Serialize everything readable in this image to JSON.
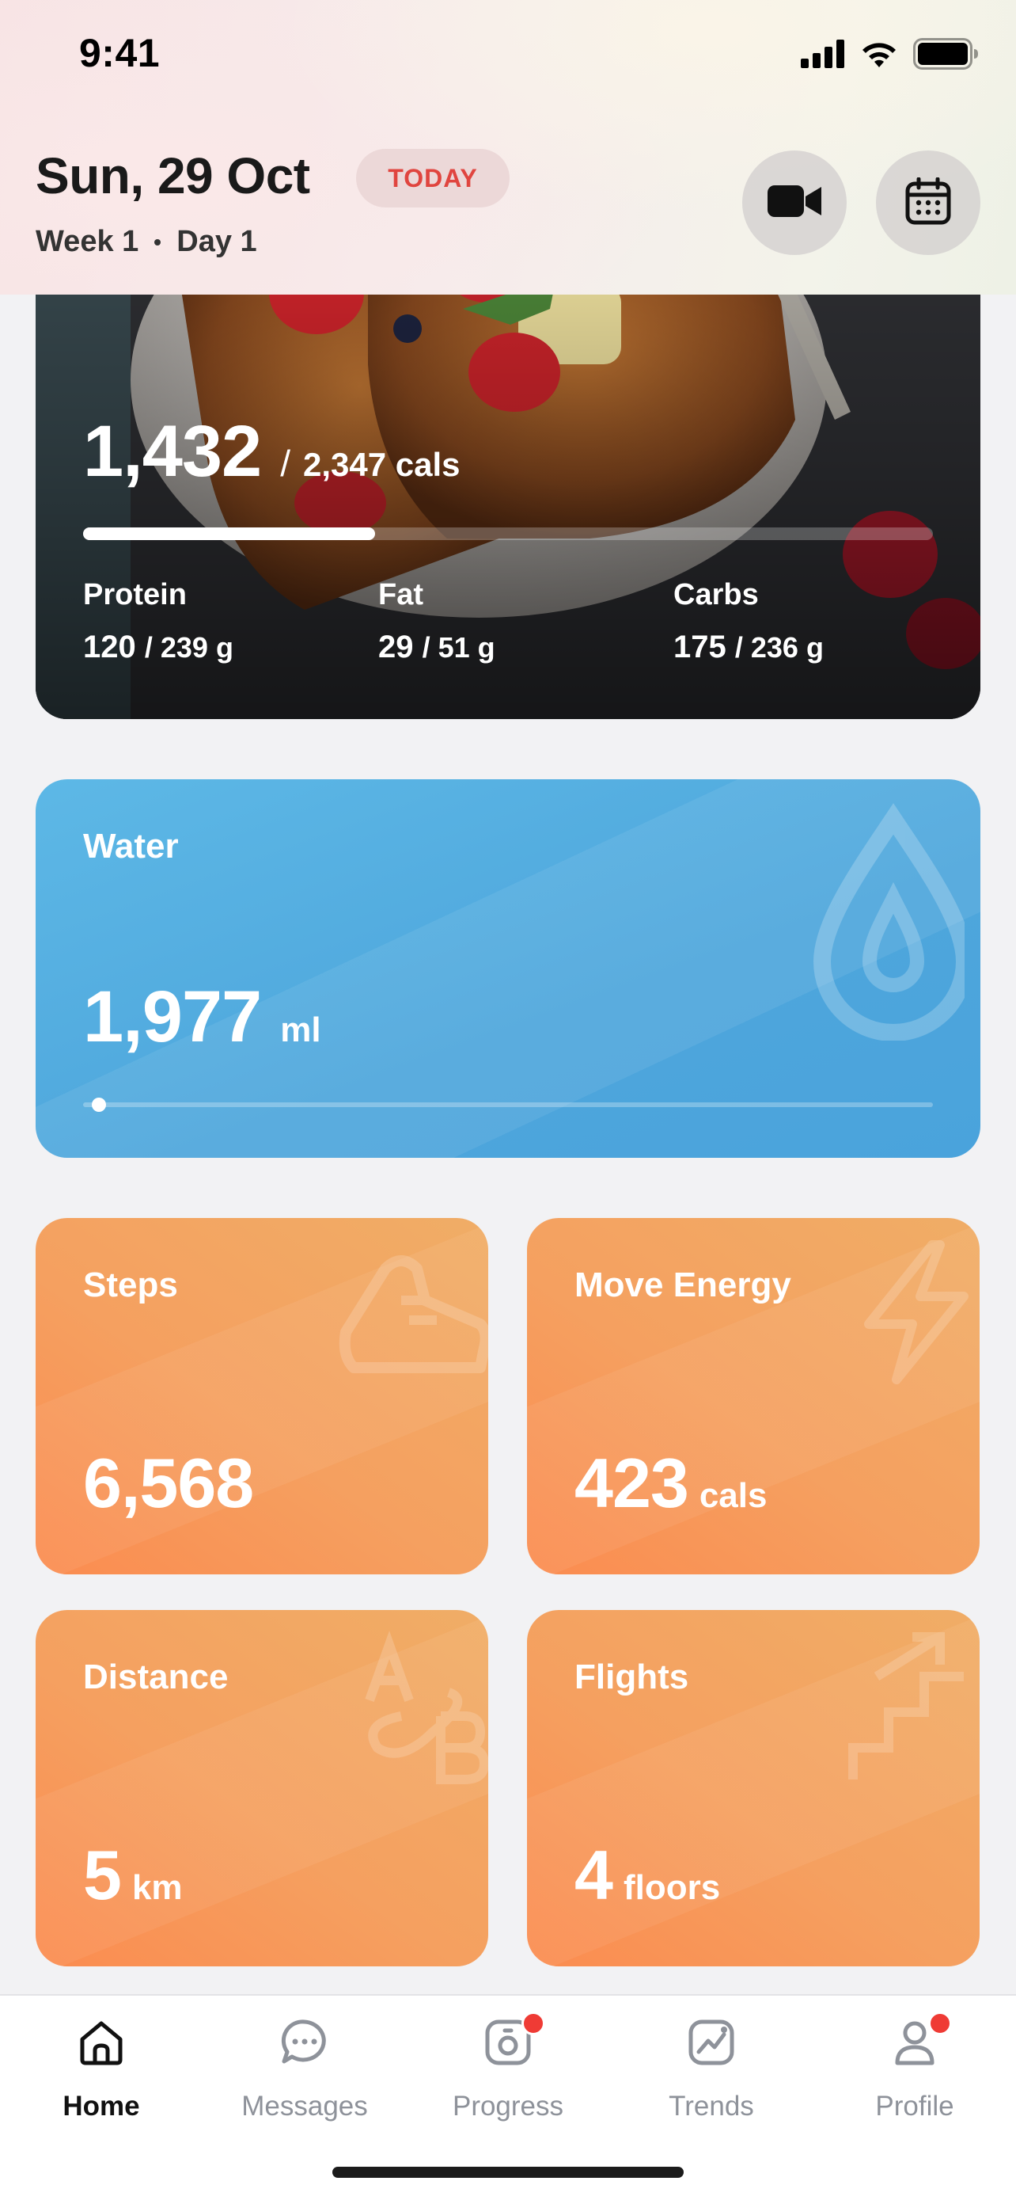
{
  "status_bar": {
    "time": "9:41"
  },
  "header": {
    "date": "Sun, 29 Oct",
    "today_badge": "TODAY",
    "week": "Week 1",
    "day": "Day 1",
    "icons": [
      "video-camera-icon",
      "calendar-icon"
    ]
  },
  "nutrition": {
    "calories_eaten": "1,432",
    "separator": "/",
    "calories_goal": "2,347 cals",
    "progress_fraction": 0.344,
    "macros": [
      {
        "label": "Protein",
        "value": "120",
        "goal": "/ 239 g"
      },
      {
        "label": "Fat",
        "value": "29",
        "goal": "/ 51 g"
      },
      {
        "label": "Carbs",
        "value": "175",
        "goal": "/ 236 g"
      }
    ]
  },
  "water": {
    "title": "Water",
    "value": "1,977",
    "unit": "ml",
    "progress_fraction": 0.01
  },
  "activity": {
    "steps": {
      "title": "Steps",
      "value": "6,568",
      "unit": ""
    },
    "move_energy": {
      "title": "Move Energy",
      "value": "423",
      "unit": "cals"
    },
    "distance": {
      "title": "Distance",
      "value": "5",
      "unit": "km"
    },
    "flights": {
      "title": "Flights",
      "value": "4",
      "unit": "floors"
    }
  },
  "tabbar": {
    "tabs": [
      {
        "label": "Home",
        "icon": "home-icon",
        "active": true,
        "badge": false
      },
      {
        "label": "Messages",
        "icon": "chat-bubble-icon",
        "active": false,
        "badge": false
      },
      {
        "label": "Progress",
        "icon": "scale-icon",
        "active": false,
        "badge": true
      },
      {
        "label": "Trends",
        "icon": "trend-chart-icon",
        "active": false,
        "badge": false
      },
      {
        "label": "Profile",
        "icon": "person-icon",
        "active": false,
        "badge": true
      }
    ]
  },
  "colors": {
    "today_badge_text": "#e0453f",
    "water_card": "#4ea6dc",
    "activity_tile": "#f5a060",
    "notification_badge": "#ef3b35"
  }
}
